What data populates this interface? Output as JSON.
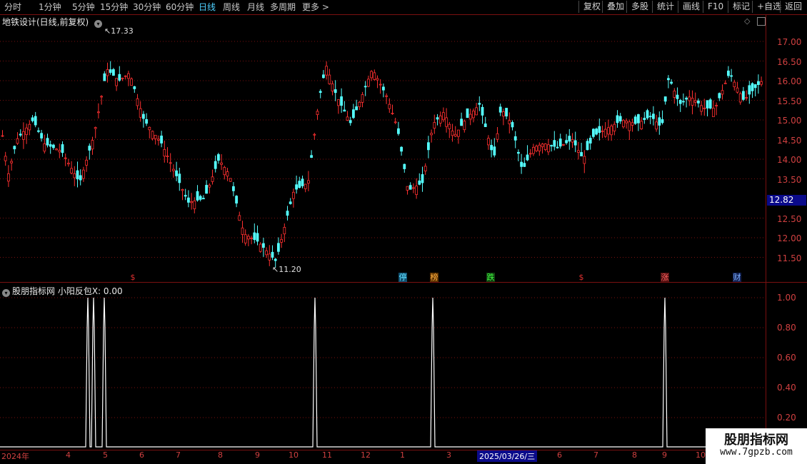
{
  "toolbar": {
    "periods": [
      "分时",
      "1分钟",
      "5分钟",
      "15分钟",
      "30分钟",
      "60分钟",
      "日线",
      "周线",
      "月线",
      "多周期",
      "更多"
    ],
    "more_glyph": ">",
    "right_buttons": [
      "复权",
      "叠加",
      "多股",
      "统计",
      "画线",
      "F10",
      "标记",
      "+自选",
      "返回"
    ]
  },
  "main": {
    "title": "地铁设计(日线,前复权)",
    "price_labels": [
      "17.00",
      "16.50",
      "16.00",
      "15.50",
      "15.00",
      "14.50",
      "14.00",
      "13.50",
      "12.50",
      "12.00",
      "11.50"
    ],
    "current_price": "12.82",
    "high_label": "17.33",
    "low_label": "11.20",
    "markers": [
      {
        "text": "$",
        "color": "#e03030",
        "bg": "transparent"
      },
      {
        "text": "停",
        "color": "#60e0ff",
        "bg": "#105070"
      },
      {
        "text": "榜",
        "color": "#ffb040",
        "bg": "#5a3000"
      },
      {
        "text": "跌",
        "color": "#40ff40",
        "bg": "#104010"
      },
      {
        "text": "$",
        "color": "#e03030",
        "bg": "transparent"
      },
      {
        "text": "涨",
        "color": "#ff6060",
        "bg": "#501010"
      },
      {
        "text": "财",
        "color": "#80b0ff",
        "bg": "#102050"
      }
    ]
  },
  "indicator": {
    "title": "股朋指标网  小阳反包X: 0.00",
    "y_labels": [
      "1.00",
      "0.80",
      "0.60",
      "0.40",
      "0.20"
    ]
  },
  "x_axis": {
    "labels": [
      "2024年",
      "4",
      "5",
      "6",
      "7",
      "8",
      "9",
      "10",
      "11",
      "12",
      "1",
      "3",
      "2025/03/26/三",
      "6",
      "7",
      "8",
      "9",
      "10"
    ]
  },
  "watermark": {
    "line1": "股朋指标网",
    "line2": "www.7gpzb.com"
  },
  "colors": {
    "up": "#ff3030",
    "down": "#54ffff",
    "grid": "#7a1010",
    "signal": "#ffffff"
  }
}
